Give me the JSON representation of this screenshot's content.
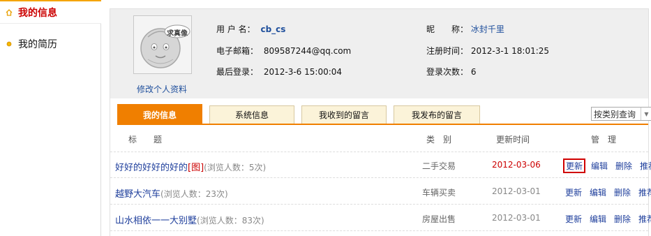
{
  "sidebar": {
    "items": [
      {
        "label": "我的信息"
      },
      {
        "label": "我的简历"
      }
    ]
  },
  "profile": {
    "avatar_text": "求真像",
    "edit_link": "修改个人资料",
    "username_label": "用 户 名：",
    "username": "cb_cs",
    "nickname_label": "昵　　称：",
    "nickname": "冰封千里",
    "email_label": "电子邮箱：",
    "email": "809587244@qq.com",
    "regtime_label": "注册时间：",
    "regtime": "2012-3-1 18:01:25",
    "lastlogin_label": "最后登录：",
    "lastlogin": "2012-3-6 15:00:04",
    "logincount_label": "登录次数：",
    "logincount": "6"
  },
  "tabs": [
    {
      "label": "我的信息"
    },
    {
      "label": "系统信息"
    },
    {
      "label": "我收到的留言"
    },
    {
      "label": "我发布的留言"
    }
  ],
  "filter": {
    "selected": "按类别查询"
  },
  "table": {
    "headers": {
      "title": "标　　题",
      "category": "类　别",
      "updated": "更新时间",
      "manage": "管　理"
    },
    "rows": [
      {
        "title": "好好的好好的好的",
        "img_tag": "[图]",
        "views": "(浏览人数：5次)",
        "category": "二手交易",
        "date": "2012-03-06"
      },
      {
        "title": "越野大汽车",
        "img_tag": "",
        "views": "(浏览人数：23次)",
        "category": "车辆买卖",
        "date": "2012-03-01"
      },
      {
        "title": "山水相依一一大别墅",
        "img_tag": "",
        "views": "(浏览人数：83次)",
        "category": "房屋出售",
        "date": "2012-03-01"
      }
    ],
    "actions": {
      "refresh": "更新",
      "edit": "编辑",
      "delete": "删除",
      "recommend": "推荐"
    }
  },
  "colors": {
    "accent": "#f07f00",
    "link": "#1f3f9c",
    "highlight": "#cc0000"
  }
}
